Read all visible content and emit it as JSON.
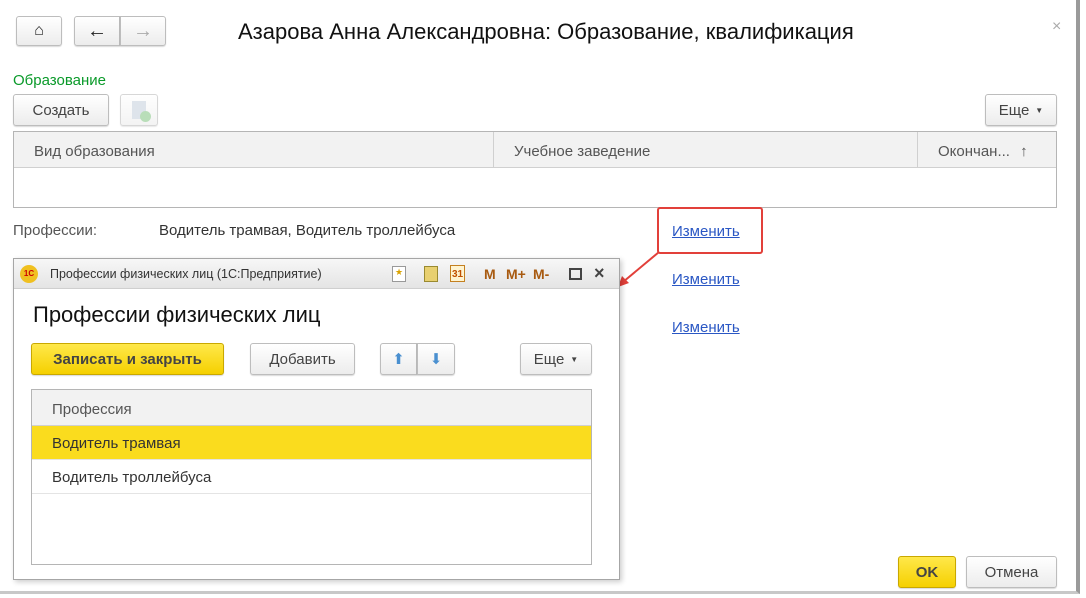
{
  "window": {
    "title": "Азарова Анна Александровна: Образование, квалификация",
    "close": "×"
  },
  "education": {
    "section_label": "Образование",
    "create_label": "Создать",
    "more_label": "Еще",
    "columns": [
      "Вид образования",
      "Учебное заведение",
      "Окончан..."
    ],
    "sort_icon": "↑"
  },
  "professions": {
    "label": "Профессии:",
    "value": "Водитель трамвая, Водитель троллейбуса",
    "change_links": [
      "Изменить",
      "Изменить",
      "Изменить"
    ]
  },
  "dialog": {
    "window_title": "Профессии физических лиц  (1С:Предприятие)",
    "logo": "1С",
    "heading": "Профессии физических лиц",
    "save_close_label": "Записать и закрыть",
    "add_label": "Добавить",
    "more_label": "Еще",
    "toolbar": {
      "m": "M",
      "mplus": "M+",
      "mminus": "M-",
      "calendar": "31"
    },
    "column": "Профессия",
    "rows": [
      "Водитель трамвая",
      "Водитель троллейбуса"
    ],
    "selected_row": 0
  },
  "footer": {
    "ok_label": "OK",
    "cancel_label": "Отмена"
  },
  "colors": {
    "accent_yellow": "#f9dc1c",
    "link": "#2a57c4",
    "highlight": "#e2403a",
    "green": "#0a9a2a"
  }
}
